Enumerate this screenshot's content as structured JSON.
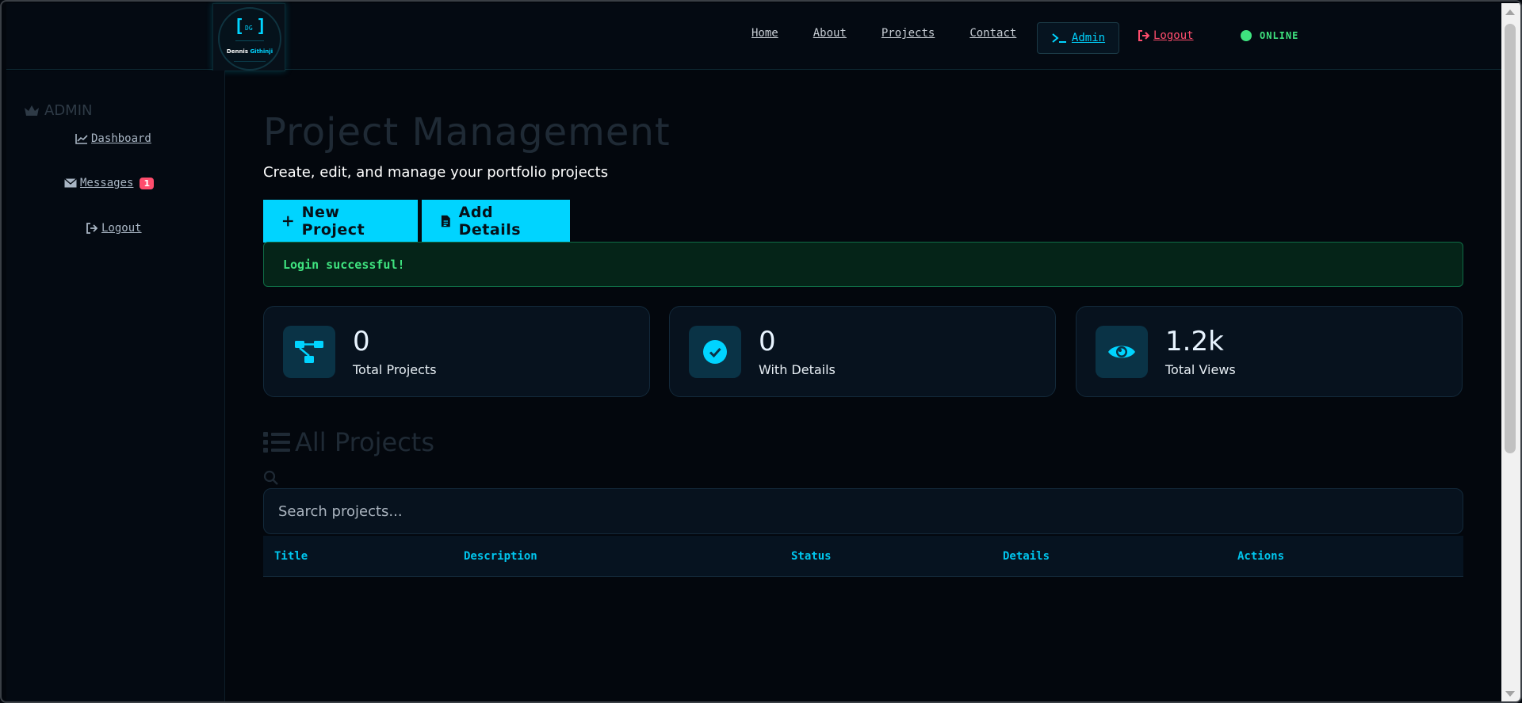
{
  "logo": {
    "initials": "DG",
    "first_name": "Dennis",
    "last_name": "Githinji"
  },
  "nav": {
    "links": [
      "Home",
      "About",
      "Projects",
      "Contact"
    ],
    "admin_label": "Admin",
    "logout_label": "Logout",
    "status_label": "ONLINE"
  },
  "sidebar": {
    "title": "ADMIN",
    "items": [
      {
        "label": "Dashboard",
        "icon": "chart-line-icon"
      },
      {
        "label": "Messages",
        "icon": "envelope-icon",
        "badge": "1"
      },
      {
        "label": "Logout",
        "icon": "sign-out-icon"
      }
    ]
  },
  "main": {
    "title": "Project Management",
    "subtitle": "Create, edit, and manage your portfolio projects",
    "buttons": {
      "new_project": "New Project",
      "add_details": "Add Details"
    },
    "alert": "Login successful!",
    "stats": [
      {
        "value": "0",
        "label": "Total Projects",
        "icon": "project-diagram-icon"
      },
      {
        "value": "0",
        "label": "With Details",
        "icon": "check-circle-icon"
      },
      {
        "value": "1.2k",
        "label": "Total Views",
        "icon": "eye-icon"
      }
    ],
    "section_title": "All Projects",
    "search_placeholder": "Search projects...",
    "table_headers": [
      "Title",
      "Description",
      "Status",
      "Details",
      "Actions"
    ]
  },
  "colors": {
    "accent": "#00d4ff",
    "success": "#3fe37f",
    "danger": "#ff4d6d",
    "background": "#03070d"
  }
}
